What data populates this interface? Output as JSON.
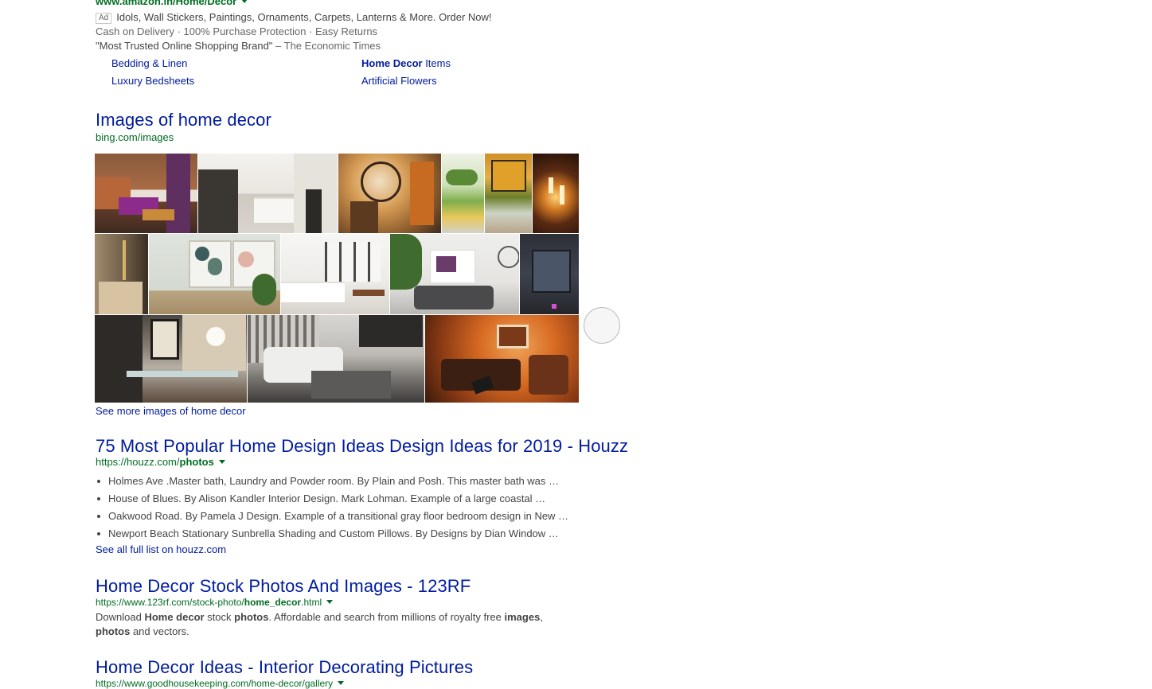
{
  "ad": {
    "url": "www.amazon.in/Home/Decor",
    "badge": "Ad",
    "line1": "Idols, Wall Stickers, Paintings, Ornaments, Carpets, Lanterns & More. Order Now!",
    "line2": "Cash on Delivery · 100% Purchase Protection · Easy Returns",
    "line3_quote": "\"Most Trusted Online Shopping Brand\"",
    "line3_source": " – The Economic Times",
    "sitelinks": [
      "Bedding & Linen",
      "Luxury Bedsheets",
      "Artificial Flowers"
    ],
    "sitelink_items_bold": "Home Decor",
    "sitelink_items_rest": " Items"
  },
  "images_section": {
    "title": "Images of home decor",
    "source": "bing.com/images",
    "see_more": "See more images of home decor"
  },
  "result1": {
    "title": "75 Most Popular Home Design Ideas Design Ideas for 2019 - Houzz",
    "url_prefix": "https://houzz.com/",
    "url_bold": "photos",
    "bullets": [
      "Holmes Ave .Master bath, Laundry and Powder room. By Plain and Posh. This master bath was …",
      "House of Blues. By Alison Kandler Interior Design. Mark Lohman. Example of a large coastal …",
      "Oakwood Road. By Pamela J Design. Example of a transitional gray floor bedroom design in New …",
      "Newport Beach Stationary Sunbrella Shading and Custom Pillows. By Designs by Dian Window …"
    ],
    "see_all": "See all full list on houzz.com"
  },
  "result2": {
    "title": "Home Decor Stock Photos And Images - 123RF",
    "url_prefix": "https://www.123rf.com/stock-photo/",
    "url_bold": "home_decor",
    "url_suffix": ".html",
    "snippet": {
      "t1": "Download ",
      "b1": "Home decor",
      "t2": " stock ",
      "b2": "photos",
      "t3": ". Affordable and search from millions of royalty free ",
      "b3": "images",
      "t4": ",",
      "b4": "photos",
      "t5": " and vectors."
    }
  },
  "result3": {
    "title": "Home Decor Ideas - Interior Decorating Pictures",
    "url": "https://www.goodhousekeeping.com/home-decor/gallery"
  },
  "colors": {
    "link": "#001ba0",
    "url_green": "#006d21",
    "text": "#444444"
  }
}
